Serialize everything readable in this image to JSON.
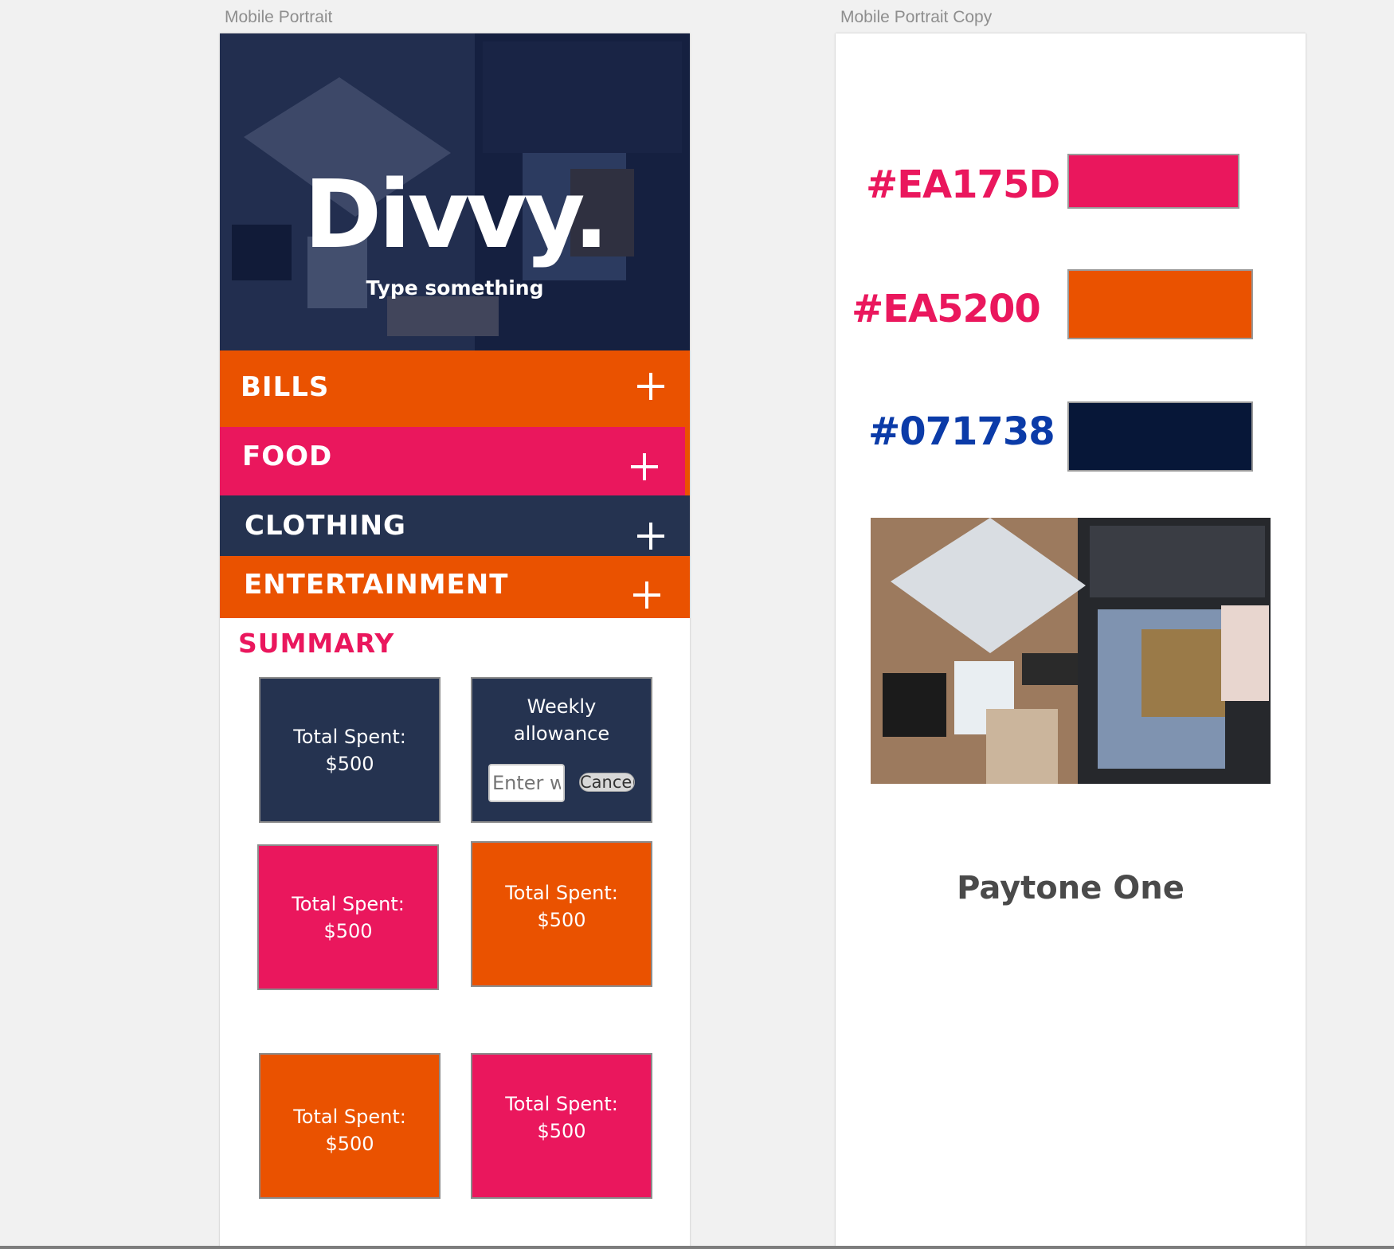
{
  "artboards": {
    "left_label": "Mobile Portrait",
    "right_label": "Mobile Portrait Copy"
  },
  "app": {
    "title": "Divvy.",
    "subtitle": "Type something"
  },
  "categories": [
    {
      "label": "BILLS",
      "color": "#EA5200"
    },
    {
      "label": "FOOD",
      "color": "#EA175D"
    },
    {
      "label": "CLOTHING",
      "color": "#253350"
    },
    {
      "label": "ENTERTAINMENT",
      "color": "#EA5200"
    }
  ],
  "summary": {
    "title": "SUMMARY",
    "card_total": "Total Spent:\n$500",
    "allowance": {
      "label": "Weekly\nallowance",
      "placeholder": "Enter weekly allowance",
      "cancel": "Cancel"
    }
  },
  "style_guide": {
    "colors": [
      {
        "hex": "#EA175D",
        "text_color": "#EA175D"
      },
      {
        "hex": "#EA5200",
        "text_color": "#EA175D"
      },
      {
        "hex": "#071738",
        "text_color": "#0B3BA8"
      }
    ],
    "font": "Paytone One"
  }
}
